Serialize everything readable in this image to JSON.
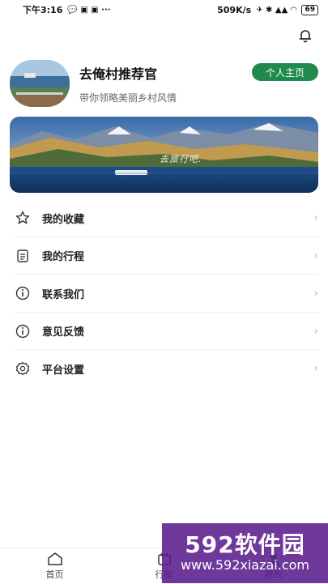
{
  "status_bar": {
    "time": "下午3:16",
    "left_icons": "💬 ▣ ▣ ···",
    "speed": "509K/s",
    "right_icons": "✈ ✱ ▲▲ ◠",
    "battery": "69"
  },
  "header": {
    "bell_icon": "bell-icon"
  },
  "profile": {
    "name": "去俺村推荐官",
    "slogan": "带你领略美丽乡村风情",
    "homepage_button": "个人主页"
  },
  "banner": {
    "text": "去旅行吧."
  },
  "menu": [
    {
      "label": "我的收藏",
      "icon": "star-icon"
    },
    {
      "label": "我的行程",
      "icon": "document-icon"
    },
    {
      "label": "联系我们",
      "icon": "info-icon"
    },
    {
      "label": "意见反馈",
      "icon": "info-icon"
    },
    {
      "label": "平台设置",
      "icon": "settings-icon"
    }
  ],
  "tabbar": {
    "tabs": [
      {
        "label": "首页",
        "icon": "home-icon"
      },
      {
        "label": "行程",
        "icon": "itinerary-icon"
      },
      {
        "label": "我的",
        "icon": "profile-icon"
      }
    ]
  },
  "watermark": {
    "title": "592软件园",
    "url": "www.592xiazai.com"
  },
  "colors": {
    "accent": "#1f8a4c",
    "watermark": "#5a1e8c"
  }
}
